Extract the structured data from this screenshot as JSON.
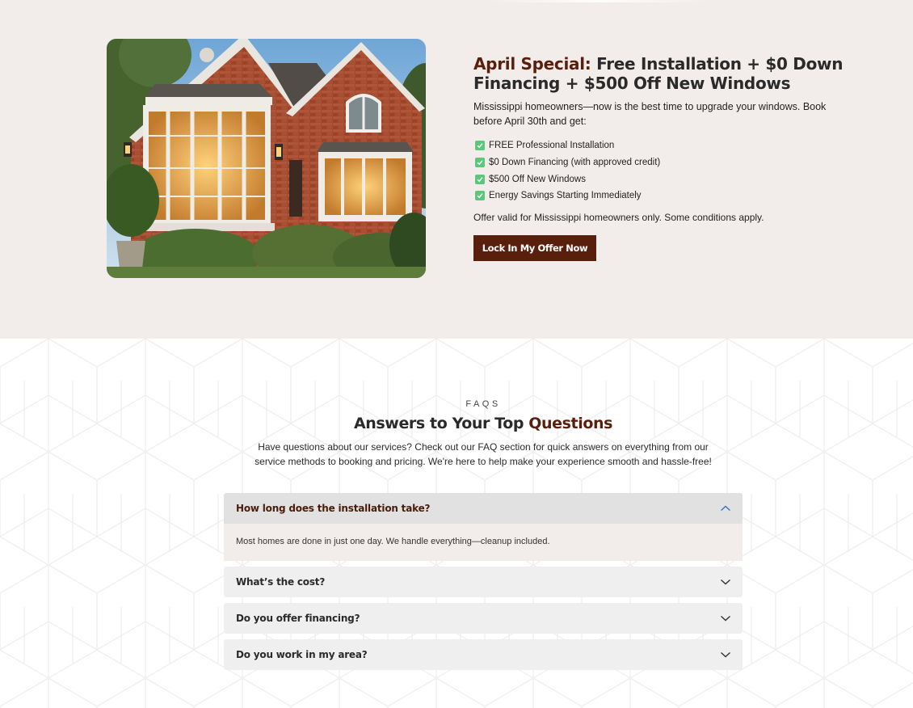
{
  "promo": {
    "title_accent": "April Special:",
    "title_rest": " Free Installation + $0 Down Financing + $500 Off New Windows",
    "intro": "Mississippi homeowners—now is the best time to upgrade your windows. Book before April 30th and get:",
    "benefits": [
      "FREE Professional Installation",
      "$0 Down Financing (with approved credit)",
      "$500 Off New Windows",
      "Energy Savings Starting Immediately"
    ],
    "note": "Offer valid for Mississippi homeowners only. Some conditions apply.",
    "cta_label": "Lock In My Offer Now",
    "image_subject": "brick-house-with-bay-windows"
  },
  "faq": {
    "eyebrow": "FAQS",
    "heading_main": "Answers to Your Top ",
    "heading_accent": "Questions",
    "subtitle": "Have questions about our services? Check out our FAQ section for quick answers on everything from our service methods to booking and pricing. We're here to help make your experience smooth and hassle-free!",
    "items": [
      {
        "question": "How long does the installation take?",
        "answer": "Most homes are done in just one day. We handle everything—cleanup included.",
        "expanded": true
      },
      {
        "question": "What’s the cost?",
        "expanded": false
      },
      {
        "question": "Do you offer financing?",
        "expanded": false
      },
      {
        "question": "Do you work in my area?",
        "expanded": false
      }
    ]
  },
  "colors": {
    "brand": "#5a1f0c",
    "promo_bg": "#f2ecea",
    "check": "#5ac77a",
    "chevron_open": "#3a6fd1",
    "chevron_closed": "#333333"
  },
  "icons": {
    "check": "check-square-icon",
    "chevron_up": "chevron-up-icon",
    "chevron_down": "chevron-down-icon"
  }
}
